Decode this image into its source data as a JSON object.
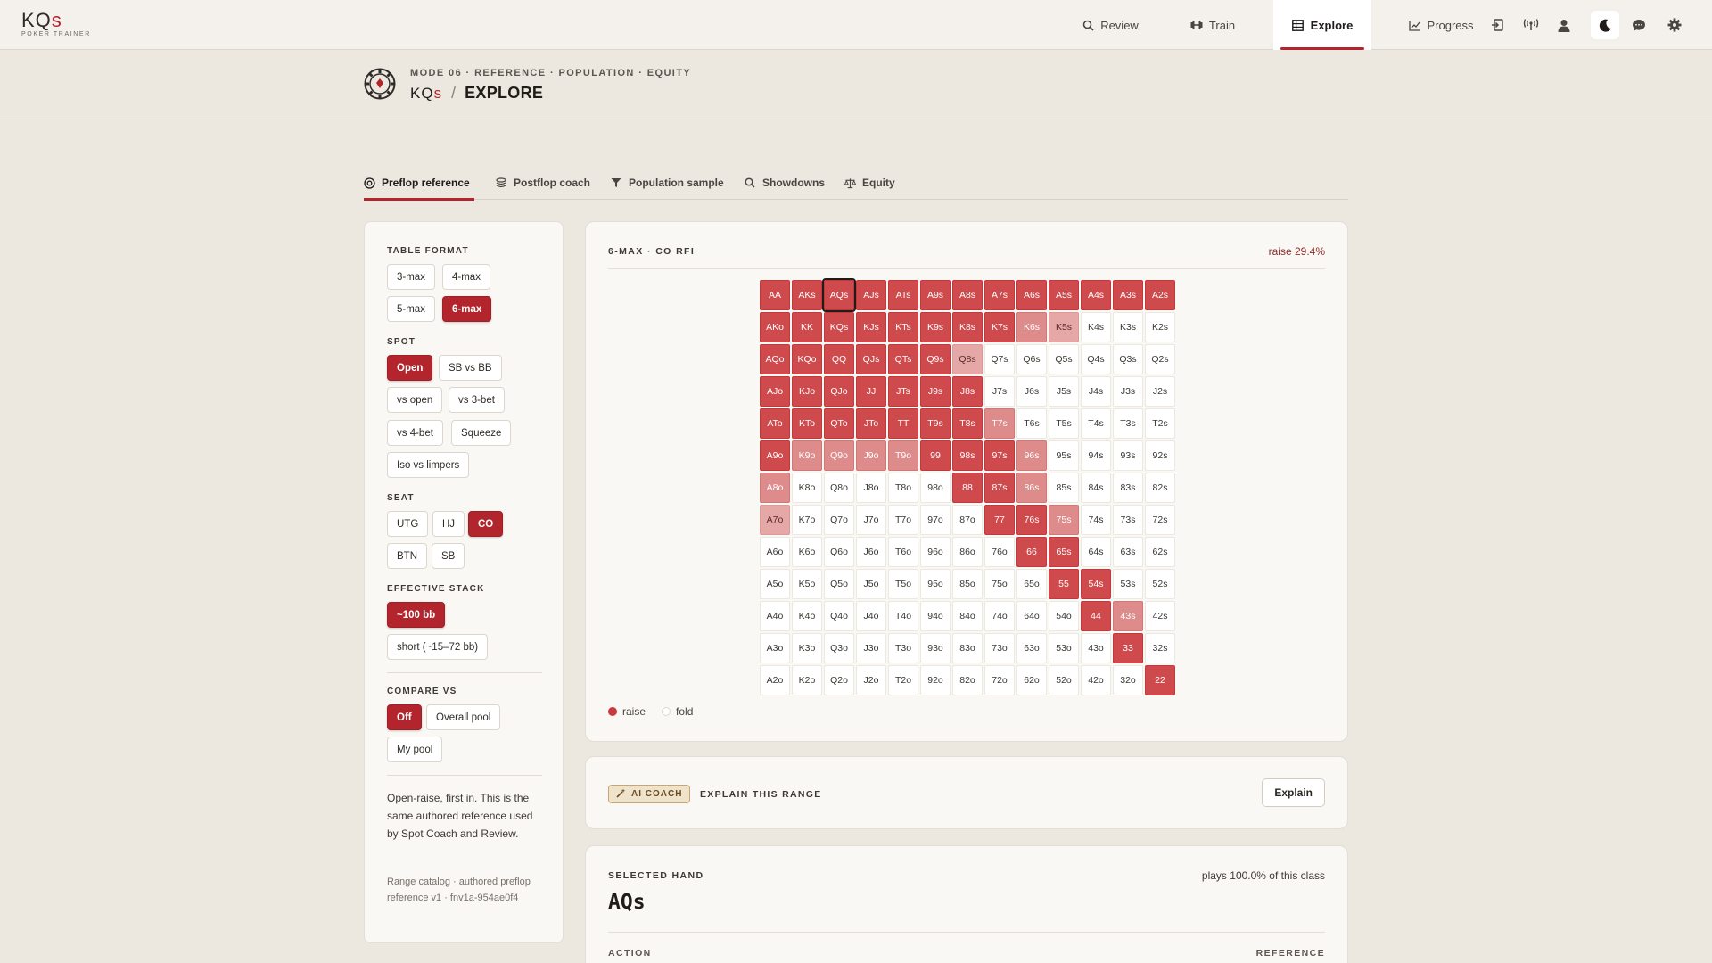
{
  "app": {
    "logo_text": "KQ",
    "logo_suffix": "s",
    "logo_subtitle": "POKER TRAINER"
  },
  "nav": {
    "items": [
      {
        "label": "Review",
        "icon": "search-icon"
      },
      {
        "label": "Train",
        "icon": "dumbbell-icon"
      },
      {
        "label": "Explore",
        "icon": "grid-icon",
        "active": true
      },
      {
        "label": "Progress",
        "icon": "chart-line-icon"
      }
    ],
    "utility_icons": [
      "import-icon",
      "broadcast-icon",
      "user-icon",
      "moon-icon",
      "chat-icon",
      "gear-icon"
    ]
  },
  "header": {
    "eyebrow": "MODE 06 · REFERENCE · POPULATION · EQUITY",
    "brand": "KQ",
    "brand_suffix": "s",
    "separator": "/",
    "title": "EXPLORE"
  },
  "tabs": [
    {
      "label": "Preflop reference",
      "icon": "target-icon",
      "active": true
    },
    {
      "label": "Postflop coach",
      "icon": "stack-icon"
    },
    {
      "label": "Population sample",
      "icon": "filter-icon"
    },
    {
      "label": "Showdowns",
      "icon": "search-icon"
    },
    {
      "label": "Equity",
      "icon": "scale-icon"
    }
  ],
  "filters": {
    "table_format": {
      "label": "TABLE FORMAT",
      "options": [
        "3-max",
        "4-max",
        "5-max",
        "6-max"
      ],
      "selected": "6-max"
    },
    "spot": {
      "label": "SPOT",
      "options": [
        "Open",
        "SB vs BB",
        "vs open",
        "vs 3-bet",
        "vs 4-bet",
        "Squeeze",
        "Iso vs limpers"
      ],
      "selected": "Open"
    },
    "seat": {
      "label": "SEAT",
      "options": [
        "UTG",
        "HJ",
        "CO",
        "BTN",
        "SB"
      ],
      "selected": "CO"
    },
    "effective_stack": {
      "label": "EFFECTIVE STACK",
      "options": [
        "~100 bb",
        "short (~15–72 bb)"
      ],
      "selected": "~100 bb"
    },
    "compare_vs": {
      "label": "COMPARE VS",
      "options": [
        "Off",
        "Overall pool",
        "My pool"
      ],
      "selected": "Off"
    },
    "description": "Open-raise, first in. This is the same authored reference used by Spot Coach and Review.",
    "catalog": "Range catalog · authored preflop reference v1 · fnv1a-954ae0f4"
  },
  "range": {
    "title": "6-MAX · CO RFI",
    "summary": "raise 29.4%",
    "ranks": [
      "A",
      "K",
      "Q",
      "J",
      "T",
      "9",
      "8",
      "7",
      "6",
      "5",
      "4",
      "3",
      "2"
    ],
    "raise_full": [
      "AA",
      "AKs",
      "AQs",
      "AJs",
      "ATs",
      "A9s",
      "A8s",
      "A7s",
      "A6s",
      "A5s",
      "A4s",
      "A3s",
      "A2s",
      "AKo",
      "KK",
      "KQs",
      "KJs",
      "KTs",
      "K9s",
      "K8s",
      "K7s",
      "AQo",
      "KQo",
      "QQ",
      "QJs",
      "QTs",
      "Q9s",
      "AJo",
      "KJo",
      "QJo",
      "JJ",
      "JTs",
      "J9s",
      "J8s",
      "ATo",
      "KTo",
      "QTo",
      "JTo",
      "TT",
      "T9s",
      "T8s",
      "A9o",
      "99",
      "98s",
      "97s",
      "88",
      "87s",
      "77",
      "76s",
      "66",
      "65s",
      "55",
      "54s",
      "44",
      "33",
      "22"
    ],
    "raise_mixed": [
      "K6s",
      "K9o",
      "Q9o",
      "J9o",
      "T9o",
      "A8o",
      "86s",
      "96s",
      "T7s",
      "75s",
      "43s"
    ],
    "raise_partial": [
      "K5s",
      "Q8s",
      "A7o"
    ],
    "selected_cell": "AQs",
    "legend": [
      {
        "label": "raise",
        "color": "#c8393e"
      },
      {
        "label": "fold",
        "color": "#ffffff"
      }
    ],
    "colors": {
      "raise": "#cf4a4d",
      "mixed": "#dd8b8b",
      "partial": "#e6a7a7",
      "fold": "#ffffff"
    }
  },
  "coach": {
    "badge": "AI COACH",
    "title": "EXPLAIN THIS RANGE",
    "button": "Explain"
  },
  "selected_hand": {
    "label": "SELECTED HAND",
    "frequency": "plays 100.0% of this class",
    "hand": "AQs",
    "col_action": "ACTION",
    "col_reference": "REFERENCE"
  }
}
